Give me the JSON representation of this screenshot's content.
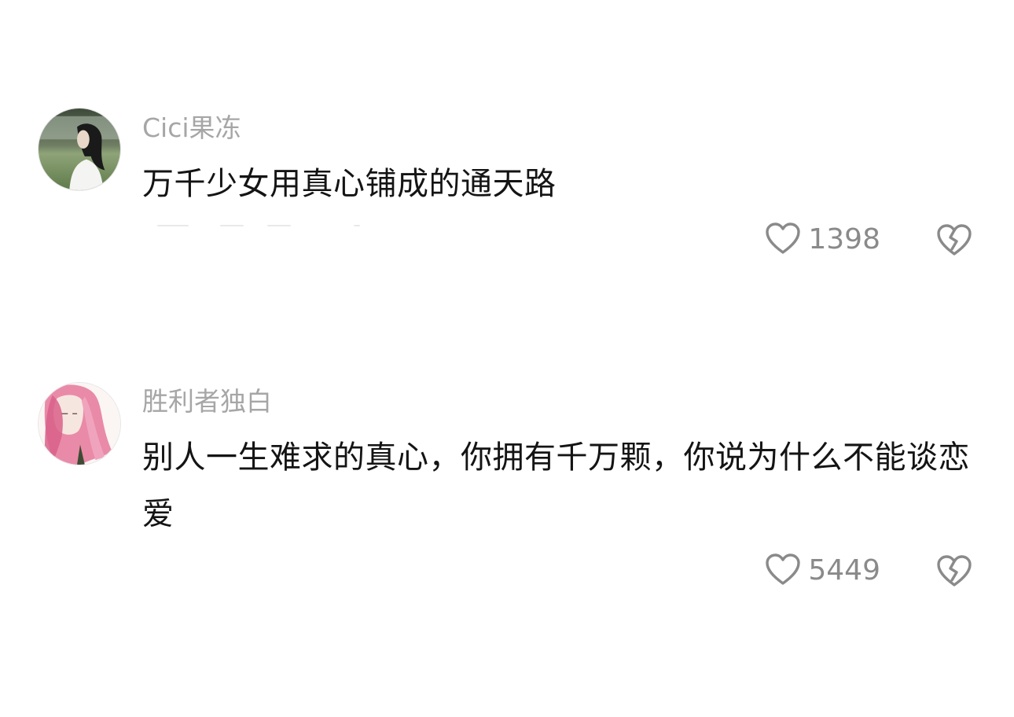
{
  "comments": [
    {
      "username": "Cici果冻",
      "text": "万千少女用真心铺成的通天路",
      "like_count": "1398",
      "avatar": "avatar-photo-girl-in-garden"
    },
    {
      "username": "胜利者独白",
      "text": "别人一生难求的真心，你拥有千万颗，你说为什么不能谈恋爱",
      "like_count": "5449",
      "avatar": "avatar-illustration-pink-hair-girl"
    }
  ],
  "icons": {
    "like": "heart-outline-icon",
    "dislike": "broken-heart-outline-icon"
  },
  "colors": {
    "username": "#a6a6a6",
    "text": "#141414",
    "icon": "#8a8a8a"
  }
}
